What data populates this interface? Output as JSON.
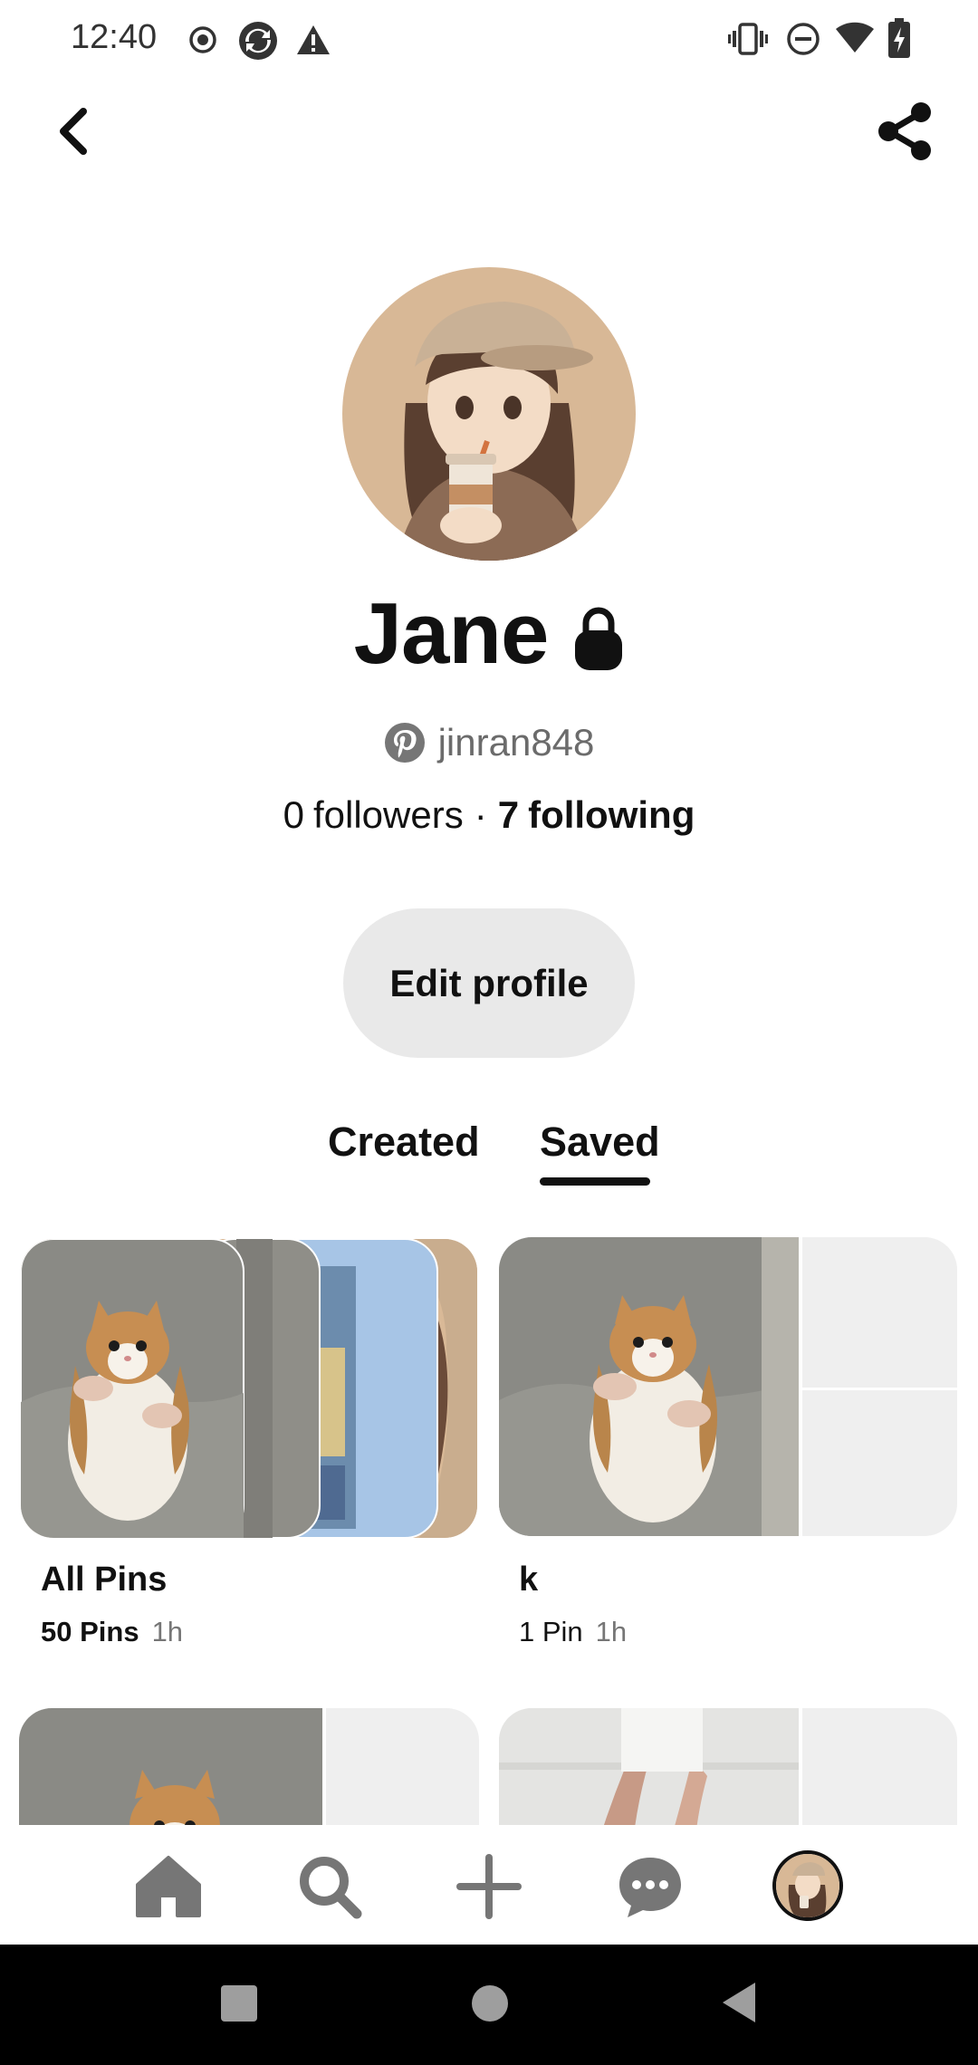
{
  "status_bar": {
    "time": "12:40",
    "left_icons": [
      "record-icon",
      "sync-icon",
      "warning-icon"
    ],
    "right_icons": [
      "vibrate-icon",
      "do-not-disturb-icon",
      "wifi-icon",
      "battery-charging-icon"
    ]
  },
  "header": {
    "back_icon": "chevron-left-icon",
    "share_icon": "share-icon"
  },
  "profile": {
    "name": "Jane",
    "private_icon": "lock-icon",
    "username": "jinran848",
    "followers_count": "0",
    "followers_label": "followers",
    "separator": "·",
    "following_count": "7",
    "following_label": "following",
    "edit_button": "Edit profile"
  },
  "tabs": [
    {
      "label": "Created",
      "active": false
    },
    {
      "label": "Saved",
      "active": true
    }
  ],
  "boards": [
    {
      "title": "All Pins",
      "count": "50 Pins",
      "time": "1h"
    },
    {
      "title": "k",
      "count": "1 Pin",
      "time": "1h"
    }
  ],
  "bottom_nav": [
    "home-icon",
    "search-icon",
    "create-icon",
    "messages-icon",
    "profile-avatar"
  ],
  "colors": {
    "text": "#111111",
    "muted": "#767676",
    "button_bg": "#e9e9e9",
    "placeholder": "#efefef"
  }
}
